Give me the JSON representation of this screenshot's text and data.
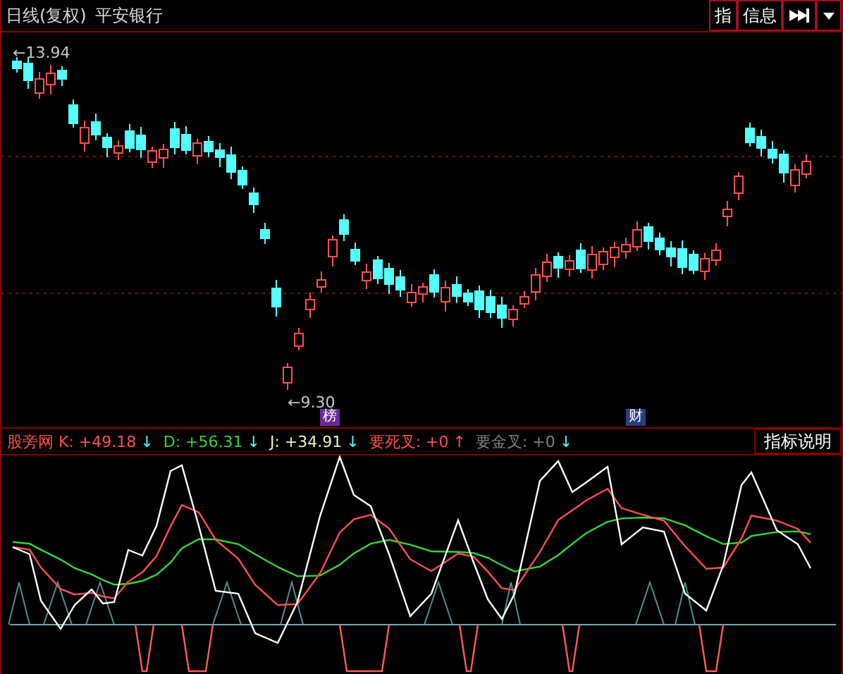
{
  "header": {
    "period": "日线(复权)",
    "stock": "平安银行"
  },
  "toolbar": [
    {
      "kind": "text",
      "label": "指"
    },
    {
      "kind": "text",
      "label": "信息"
    },
    {
      "kind": "skip"
    },
    {
      "kind": "caret"
    }
  ],
  "price_chart": {
    "high_label": "←13.94",
    "low_label": "←9.30",
    "badges": [
      {
        "label": "榜",
        "color": "#6a2a9a"
      },
      {
        "label": "财",
        "color": "#2a3f7a"
      }
    ]
  },
  "indicator": {
    "items": [
      {
        "label": "股旁网 K: +49.18",
        "color": "#ff5050",
        "arrow": "↓"
      },
      {
        "label": "D: +56.31",
        "color": "#3cd23c",
        "arrow": "↓"
      },
      {
        "label": "J: +34.91",
        "color": "#f0f0c8",
        "arrow": "↓"
      },
      {
        "label": "要死叉: +0",
        "color": "#ff5050",
        "arrow": "↑"
      },
      {
        "label": "要金叉: +0",
        "color": "#808080",
        "arrow": "↓"
      }
    ],
    "help_button": "指标说明"
  }
}
